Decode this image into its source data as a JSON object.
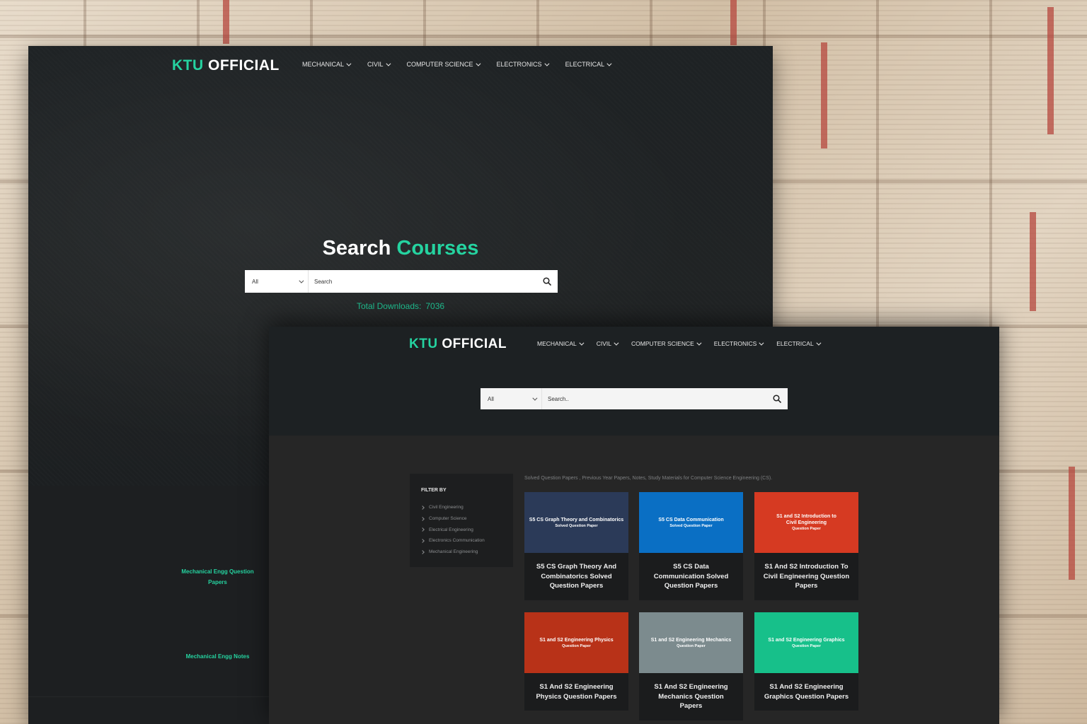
{
  "brand": {
    "logo_left": "KTU",
    "logo_right": "OFFICIAL",
    "accent": "#25d3a0"
  },
  "nav": [
    "MECHANICAL",
    "CIVIL",
    "COMPUTER SCIENCE",
    "ELECTRONICS",
    "ELECTRICAL"
  ],
  "window1": {
    "hero_title": "Search",
    "hero_title_accent": "Courses",
    "search": {
      "category": "All",
      "placeholder": "Search"
    },
    "downloads_label": "Total Downloads:",
    "downloads_value": "7036",
    "side_links": [
      "Mechanical Engg Question Papers",
      "Mechanical Engg Notes"
    ]
  },
  "window2": {
    "search": {
      "category": "All",
      "placeholder": "Search.."
    },
    "filter": {
      "title": "FILTER BY",
      "items": [
        "Civil Engineering",
        "Computer Science",
        "Electrical Engineering",
        "Electronics Communication",
        "Mechanical Engineering"
      ]
    },
    "intro": "Solved Question Papers , Previous Year Papers, Notes, Study Materials for Computer Science Engineering (CS).",
    "cards": [
      {
        "thumb_title": "S5 CS Graph Theory and Combinatorics",
        "thumb_sub": "Solved Question Paper",
        "caption": "S5 CS Graph Theory And Combinatorics Solved Question Papers",
        "color": "#2b3a58"
      },
      {
        "thumb_title": "S5 CS Data Communication",
        "thumb_sub": "Solved Question Paper",
        "caption": "S5 CS Data Communication Solved Question Papers",
        "color": "#0a6fc4"
      },
      {
        "thumb_title": "S1 and S2 Introduction to Civil Engineering",
        "thumb_sub": "Question Paper",
        "caption": "S1 And S2 Introduction To Civil Engineering Question Papers",
        "color": "#d63a22"
      },
      {
        "thumb_title": "S1 and S2 Engineering Physics",
        "thumb_sub": "Question Paper",
        "caption": "S1 And S2 Engineering Physics Question Papers",
        "color": "#b83218"
      },
      {
        "thumb_title": "S1 and S2 Engineering Mechanics",
        "thumb_sub": "Question Paper",
        "caption": "S1 And S2 Engineering Mechanics Question Papers",
        "color": "#7c8b8e"
      },
      {
        "thumb_title": "S1 and S2 Engineering Graphics",
        "thumb_sub": "Question Paper",
        "caption": "S1 And S2 Engineering Graphics Question Papers",
        "color": "#17c08a"
      }
    ]
  }
}
